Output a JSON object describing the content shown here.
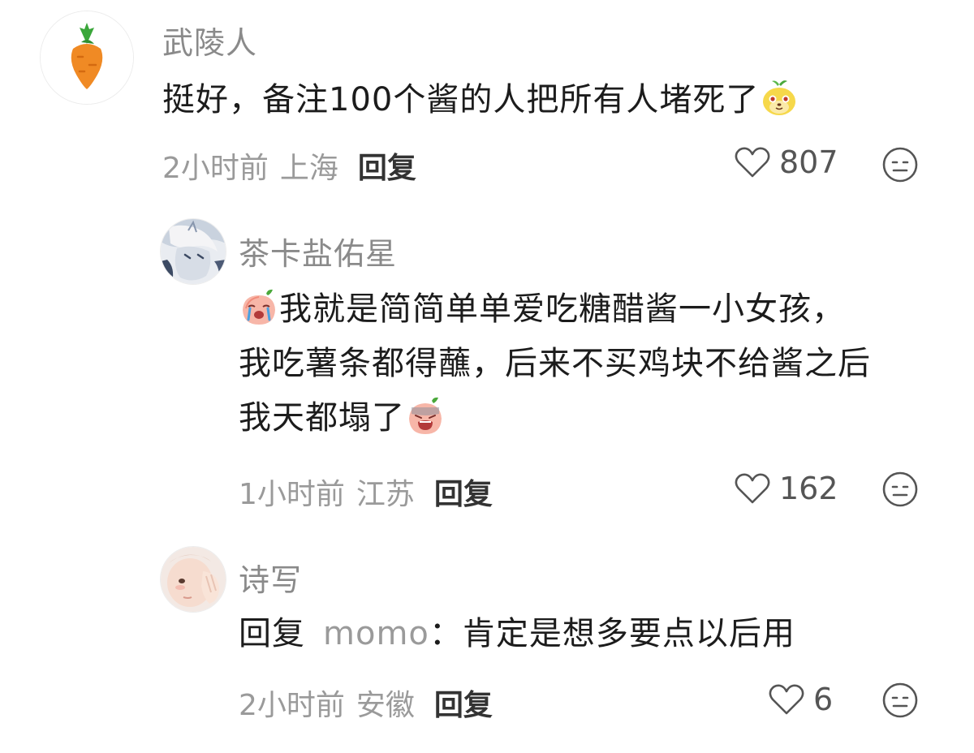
{
  "comments": [
    {
      "username": "武陵人",
      "avatar_icon": "carrot-icon",
      "lines": [
        "挺好，备注100个酱的人把所有人堵死了"
      ],
      "trailing_emoji": "yellow-sprout-face-emoji",
      "time": "2小时前",
      "location": "上海",
      "reply_label": "回复",
      "likes": "807"
    },
    {
      "username": "茶卡盐佑星",
      "avatar_icon": "anime-character-avatar",
      "leading_emoji": "crying-peach-emoji",
      "lines": [
        "我就是简简单单爱吃糖醋酱一小女孩，",
        "我吃薯条都得蘸，后来不买鸡块不给酱之后",
        "我天都塌了"
      ],
      "trailing_emoji": "despair-peach-emoji",
      "time": "1小时前",
      "location": "江苏",
      "reply_label": "回复",
      "likes": "162"
    },
    {
      "username": "诗写",
      "avatar_icon": "baby-photo-avatar",
      "reply_prefix": "回复",
      "reply_target": "momo",
      "reply_colon": "：",
      "text": "肯定是想多要点以后用",
      "time": "2小时前",
      "location": "安徽",
      "reply_label": "回复",
      "likes": "6"
    }
  ],
  "colors": {
    "username": "#8a8a8a",
    "meta": "#9a9a9a",
    "text": "#1c1c1c",
    "icon": "#666666"
  }
}
